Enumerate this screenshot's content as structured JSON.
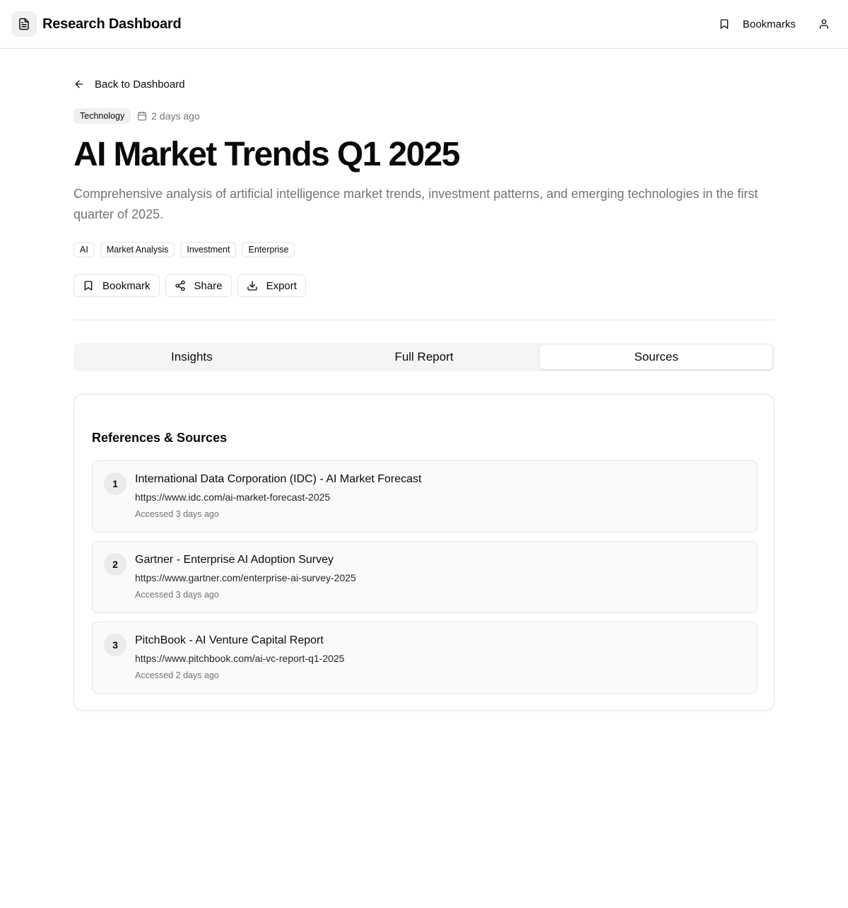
{
  "header": {
    "app_title": "Research Dashboard",
    "bookmarks_label": "Bookmarks"
  },
  "nav": {
    "back_label": "Back to Dashboard"
  },
  "report": {
    "category": "Technology",
    "date": "2 days ago",
    "title": "AI Market Trends Q1 2025",
    "description": "Comprehensive analysis of artificial intelligence market trends, investment patterns, and emerging technologies in the first quarter of 2025.",
    "tags": [
      "AI",
      "Market Analysis",
      "Investment",
      "Enterprise"
    ]
  },
  "actions": {
    "bookmark": "Bookmark",
    "share": "Share",
    "export": "Export"
  },
  "tabs": [
    {
      "label": "Insights",
      "active": false
    },
    {
      "label": "Full Report",
      "active": false
    },
    {
      "label": "Sources",
      "active": true
    }
  ],
  "sources": {
    "heading": "References & Sources",
    "items": [
      {
        "num": "1",
        "title": "International Data Corporation (IDC) - AI Market Forecast",
        "url": "https://www.idc.com/ai-market-forecast-2025",
        "accessed": "Accessed 3 days ago"
      },
      {
        "num": "2",
        "title": "Gartner - Enterprise AI Adoption Survey",
        "url": "https://www.gartner.com/enterprise-ai-survey-2025",
        "accessed": "Accessed 3 days ago"
      },
      {
        "num": "3",
        "title": "PitchBook - AI Venture Capital Report",
        "url": "https://www.pitchbook.com/ai-vc-report-q1-2025",
        "accessed": "Accessed 2 days ago"
      }
    ]
  },
  "icons": {
    "logo": "file-text-icon",
    "bookmarks": "bookmark-icon",
    "user": "user-icon",
    "back": "arrow-left-icon",
    "date": "calendar-icon",
    "share": "share-icon",
    "export": "download-icon"
  },
  "colors": {
    "text": "#0a0a0a",
    "muted": "#737373",
    "border": "#e5e5e5",
    "tab_bg": "#f5f5f5",
    "badge_bg": "#f0f0f0",
    "item_bg": "#fafafa"
  }
}
